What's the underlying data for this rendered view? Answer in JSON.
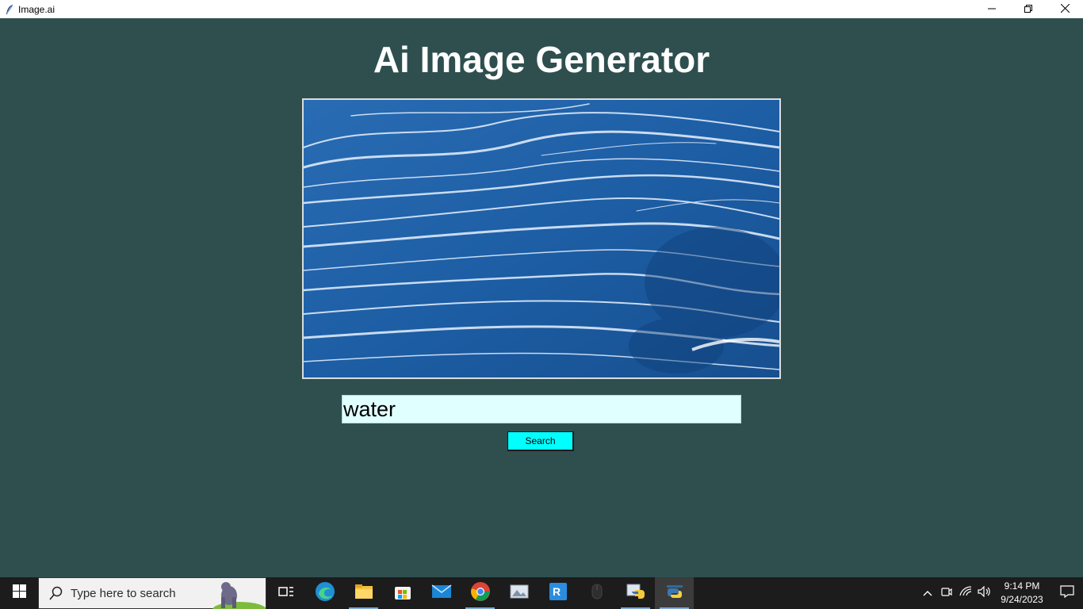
{
  "window": {
    "title": "Image.ai",
    "icon": "feather-icon",
    "controls": [
      "minimize-icon",
      "restore-icon",
      "close-icon"
    ]
  },
  "app": {
    "heading": "Ai Image Generator",
    "image_alt": "generated-image",
    "search": {
      "value": "water",
      "placeholder": ""
    },
    "search_button_label": "Search",
    "colors": {
      "background": "#2f4f4f",
      "input_background": "#e0ffff",
      "button_background": "#00ffff",
      "heading": "#ffffff"
    }
  },
  "taskbar": {
    "search_placeholder": "Type here to search",
    "apps": [
      "task-view-icon",
      "edge-icon",
      "file-explorer-icon",
      "microsoft-store-icon",
      "mail-icon",
      "chrome-icon",
      "photos-icon",
      "rstudio-icon",
      "mouse-icon",
      "python-idle-icon",
      "python-icon"
    ],
    "tray": [
      "chevron-up-icon",
      "meet-now-icon",
      "wifi-icon",
      "volume-icon"
    ],
    "clock": {
      "time": "9:14 PM",
      "date": "9/24/2023"
    }
  }
}
